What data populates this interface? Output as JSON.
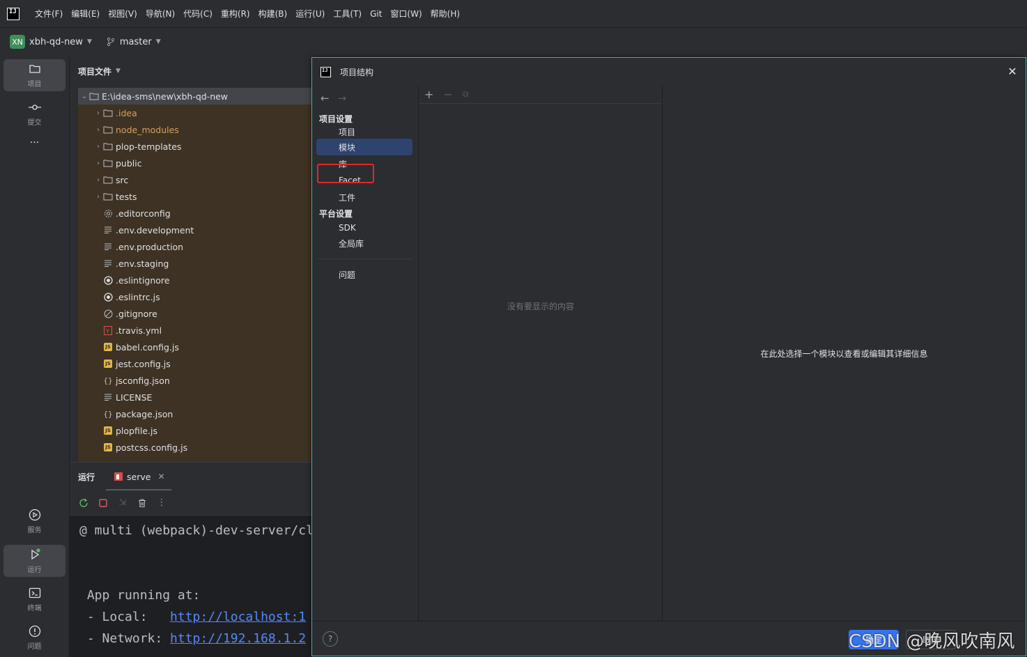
{
  "menubar": {
    "logo": "IJ",
    "items": [
      "文件(F)",
      "编辑(E)",
      "视图(V)",
      "导航(N)",
      "代码(C)",
      "重构(R)",
      "构建(B)",
      "运行(U)",
      "工具(T)",
      "Git",
      "窗口(W)",
      "帮助(H)"
    ]
  },
  "toolbar": {
    "project_badge": "XN",
    "project_name": "xbh-qd-new",
    "branch": "master"
  },
  "leftstrip": {
    "project": "项目",
    "commit": "提交",
    "more": "···",
    "services": "服务",
    "run": "运行",
    "terminal": "终端",
    "problems": "问题"
  },
  "project_panel": {
    "title": "项目文件",
    "root": "E:\\idea-sms\\new\\xbh-qd-new",
    "items": [
      {
        "name": ".idea",
        "type": "folder",
        "excluded": true
      },
      {
        "name": "node_modules",
        "type": "folder",
        "excluded": true
      },
      {
        "name": "plop-templates",
        "type": "folder"
      },
      {
        "name": "public",
        "type": "folder"
      },
      {
        "name": "src",
        "type": "folder"
      },
      {
        "name": "tests",
        "type": "folder"
      },
      {
        "name": ".editorconfig",
        "type": "gear"
      },
      {
        "name": ".env.development",
        "type": "text"
      },
      {
        "name": ".env.production",
        "type": "text"
      },
      {
        "name": ".env.staging",
        "type": "text"
      },
      {
        "name": ".eslintignore",
        "type": "eslint"
      },
      {
        "name": ".eslintrc.js",
        "type": "eslint"
      },
      {
        "name": ".gitignore",
        "type": "ignore"
      },
      {
        "name": ".travis.yml",
        "type": "yml"
      },
      {
        "name": "babel.config.js",
        "type": "js"
      },
      {
        "name": "jest.config.js",
        "type": "js"
      },
      {
        "name": "jsconfig.json",
        "type": "json"
      },
      {
        "name": "LICENSE",
        "type": "text"
      },
      {
        "name": "package.json",
        "type": "json"
      },
      {
        "name": "plopfile.js",
        "type": "js"
      },
      {
        "name": "postcss.config.js",
        "type": "js"
      }
    ]
  },
  "run_panel": {
    "title": "运行",
    "tab": "serve",
    "console_lines": [
      {
        "text": "@ multi (webpack)-dev-server/cl"
      },
      {
        "text": ""
      },
      {
        "text": ""
      },
      {
        "text": " App running at:"
      },
      {
        "text": " - Local:   ",
        "link": "http://localhost:1"
      },
      {
        "text": " - Network: ",
        "link": "http://192.168.1.2"
      }
    ]
  },
  "dialog": {
    "title": "项目结构",
    "sections": {
      "project_settings": "项目设置",
      "platform_settings": "平台设置"
    },
    "project_items": [
      "项目",
      "模块",
      "库",
      "Facet",
      "工件"
    ],
    "platform_items": [
      "SDK",
      "全局库"
    ],
    "problems": "问题",
    "selected": "模块",
    "empty_message": "没有要显示的内容",
    "detail_message": "在此处选择一个模块以查看或编辑其详细信息",
    "ok": "确定",
    "cancel": "取消",
    "help": "?"
  },
  "watermark": "CSDN @晚风吹南风"
}
